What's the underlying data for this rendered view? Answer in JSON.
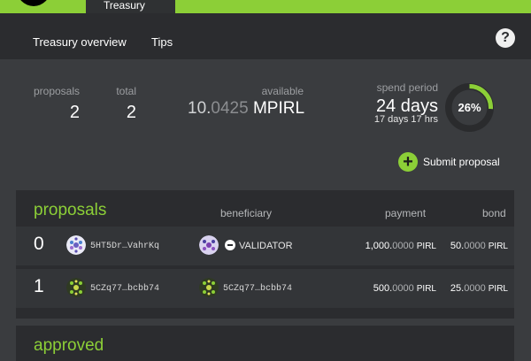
{
  "topnav": {
    "active_tab": "Treasury"
  },
  "subnav": {
    "tabs": [
      "Treasury overview",
      "Tips"
    ],
    "help": "?"
  },
  "summary": {
    "proposals_label": "proposals",
    "proposals_value": "2",
    "total_label": "total",
    "total_value": "2",
    "available_label": "available",
    "available_int": "10.",
    "available_dec": "0425",
    "available_unit": "MPIRL",
    "spend_label": "spend period",
    "spend_days": "24 days",
    "spend_sub": "17 days 17 hrs",
    "spend_percent_label": "26%",
    "spend_progress": 0.26
  },
  "submit": {
    "icon": "+",
    "label": "Submit proposal"
  },
  "proposals": {
    "title": "proposals",
    "headers": {
      "beneficiary": "beneficiary",
      "payment": "payment",
      "bond": "bond"
    },
    "rows": [
      {
        "index": "0",
        "proposer": "5HT5Dr…VahrKq",
        "beneficiary": "VALIDATOR",
        "payment_int": "1,000.",
        "payment_dec": "0000",
        "payment_unit": "PIRL",
        "bond_int": "50.",
        "bond_dec": "0000",
        "bond_unit": "PIRL"
      },
      {
        "index": "1",
        "proposer": "5CZq77…bcbb74",
        "beneficiary": "5CZq77…bcbb74",
        "payment_int": "500.",
        "payment_dec": "0000",
        "payment_unit": "PIRL",
        "bond_int": "25.",
        "bond_dec": "0000",
        "bond_unit": "PIRL"
      }
    ]
  },
  "approved": {
    "title": "approved"
  },
  "colors": {
    "accent": "#8ccf37",
    "panel": "#2b2c2f",
    "bg": "#3a3c3f"
  }
}
